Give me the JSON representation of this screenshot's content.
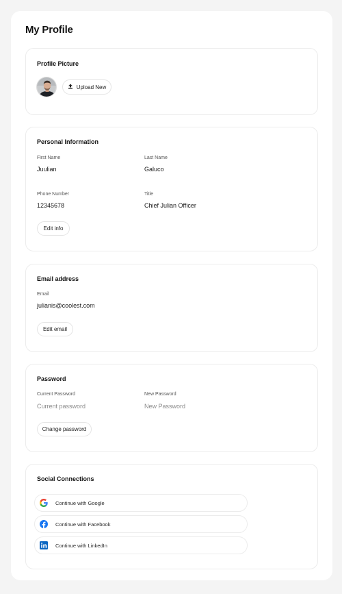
{
  "page": {
    "title": "My Profile"
  },
  "profile_picture": {
    "title": "Profile Picture",
    "upload_label": "Upload New"
  },
  "personal": {
    "title": "Personal Information",
    "first_name_label": "First Name",
    "first_name": "Juulian",
    "last_name_label": "Last Name",
    "last_name": "Galuco",
    "phone_label": "Phone Number",
    "phone": "12345678",
    "title_label": "Title",
    "job_title": "Chief Julian Officer",
    "edit_label": "Edit info"
  },
  "email": {
    "title": "Email address",
    "email_label": "Email",
    "email_value": "julianis@coolest.com",
    "edit_label": "Edit email"
  },
  "password": {
    "title": "Password",
    "current_label": "Current Password",
    "current_placeholder": "Current password",
    "new_label": "New Password",
    "new_placeholder": "New Password",
    "change_label": "Change password"
  },
  "social": {
    "title": "Social Connections",
    "google_label": "Continue with Google",
    "facebook_label": "Continue with Facebook",
    "linkedin_label": "Continue with LinkedIn"
  },
  "icons": {
    "upload": "upload-icon",
    "google": "google-icon",
    "facebook": "facebook-icon",
    "linkedin": "linkedin-icon"
  },
  "colors": {
    "facebook": "#1877F2",
    "linkedin": "#0A66C2",
    "google_blue": "#4285F4",
    "google_red": "#EA4335",
    "google_yellow": "#FBBC05",
    "google_green": "#34A853"
  }
}
